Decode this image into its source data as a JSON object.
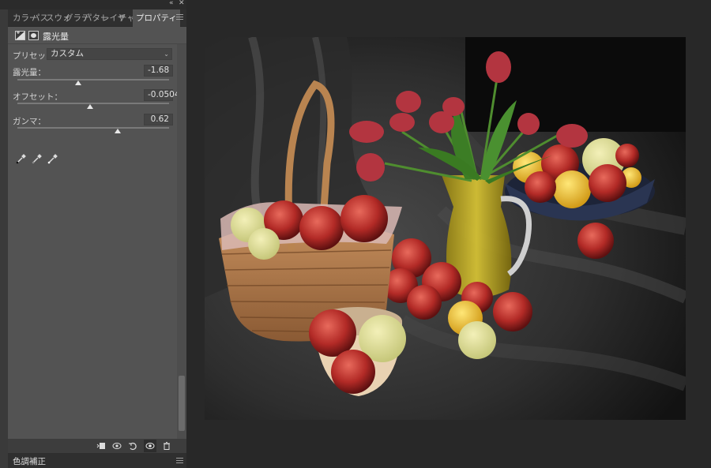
{
  "tabs": [
    "カラー",
    "パス",
    "スウォ",
    "グラデ",
    "パター",
    "レイヤ",
    "チャン",
    "プロパティ"
  ],
  "active_tab_index": 7,
  "properties": {
    "title": "露光量",
    "preset_label": "プリセット：",
    "preset_value": "カスタム",
    "exposure": {
      "label": "露光量：",
      "value": "-1.68",
      "level": 0.4
    },
    "offset": {
      "label": "オフセット：",
      "value": "-0.0504",
      "level": 0.48
    },
    "gamma": {
      "label": "ガンマ：",
      "value": "0.62",
      "level": 0.66
    }
  },
  "adjustments_tab": "色調補正",
  "icons": {
    "collapse": "double-chevron-left-icon",
    "close": "close-icon",
    "panel_menu": "hamburger-menu-icon",
    "eyedroppers": [
      "eyedropper-black-icon",
      "eyedropper-gray-icon",
      "eyedropper-white-icon"
    ],
    "bottom": [
      "clip-to-layer-icon",
      "view-previous-state-icon",
      "reset-icon",
      "visibility-eye-icon",
      "trash-icon"
    ]
  },
  "colors": {
    "panel_bg": "#535353",
    "tab_bg": "#2f2f2f",
    "app_bg": "#282828"
  }
}
